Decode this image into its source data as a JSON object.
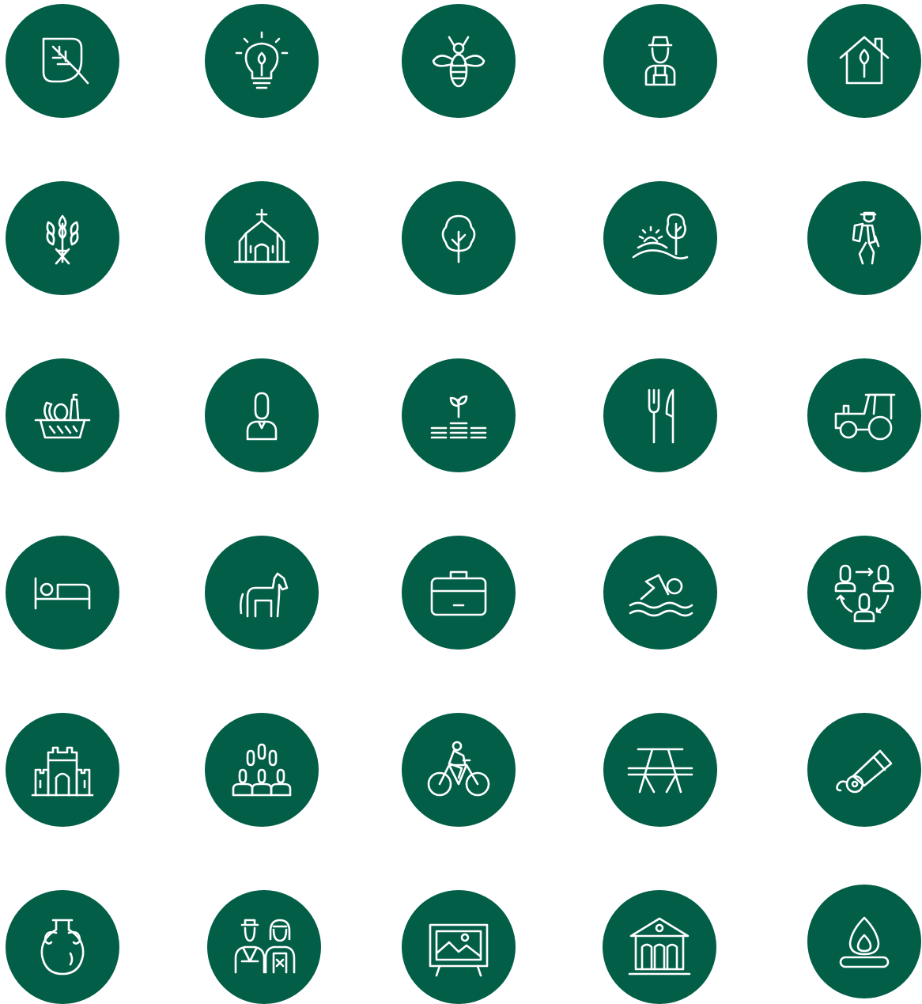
{
  "theme": {
    "circle_color": "#025E47",
    "icon_color": "#FFFFFF",
    "background": "#FFFFFF"
  },
  "icons": [
    [
      "no-leaf",
      "lightbulb-leaf",
      "bee",
      "farmer",
      "eco-house"
    ],
    [
      "wheat",
      "church",
      "tree",
      "countryside-sunrise",
      "hiker"
    ],
    [
      "food-basket",
      "person",
      "plant-coins",
      "fork-knife",
      "tractor"
    ],
    [
      "bed",
      "horse",
      "briefcase",
      "swimmer",
      "people-exchange"
    ],
    [
      "castle",
      "group",
      "cyclist",
      "picnic-table",
      "cannon"
    ],
    [
      "amphora",
      "traditional-couple",
      "painting",
      "museum",
      "campfire"
    ]
  ]
}
